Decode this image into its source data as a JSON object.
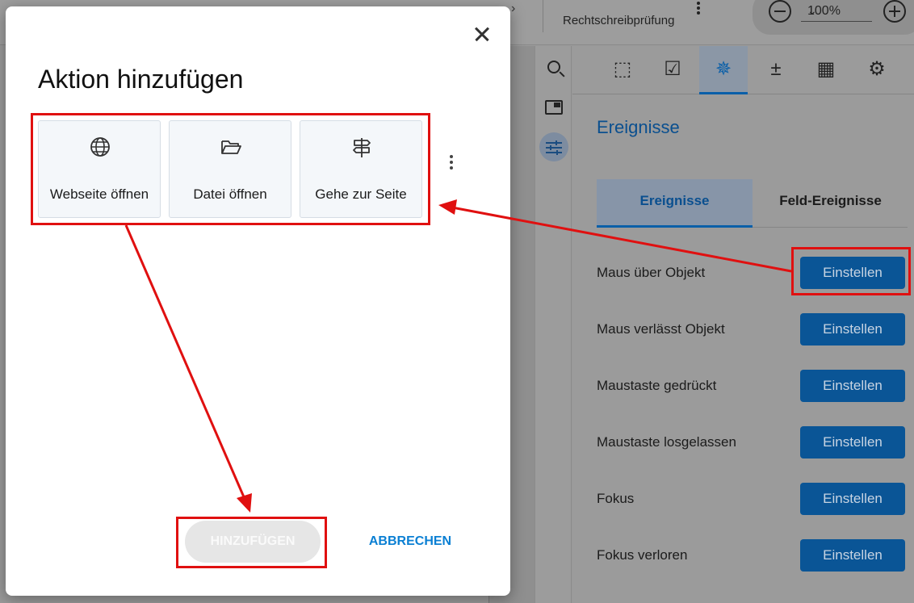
{
  "toolbar": {
    "spellcheck_label": "Rechtschreibprüfung",
    "zoom_value": "100%"
  },
  "right_panel": {
    "tabs": [
      "form-icon",
      "checkbox-icon",
      "click-events-icon",
      "calc-currency-icon",
      "calculator-icon",
      "settings-gear-icon"
    ],
    "title": "Ereignisse",
    "subtabs": [
      {
        "label": "Ereignisse",
        "active": true
      },
      {
        "label": "Feld-Ereignisse",
        "active": false
      }
    ],
    "events": [
      {
        "label": "Maus über Objekt",
        "button": "Einstellen"
      },
      {
        "label": "Maus verlässt Objekt",
        "button": "Einstellen"
      },
      {
        "label": "Maustaste gedrückt",
        "button": "Einstellen"
      },
      {
        "label": "Maustaste losgelassen",
        "button": "Einstellen"
      },
      {
        "label": "Fokus",
        "button": "Einstellen"
      },
      {
        "label": "Fokus verloren",
        "button": "Einstellen"
      }
    ]
  },
  "dialog": {
    "title": "Aktion hinzufügen",
    "actions": [
      {
        "label": "Webseite öffnen",
        "icon": "globe-icon"
      },
      {
        "label": "Datei öffnen",
        "icon": "folder-open-icon"
      },
      {
        "label": "Gehe zur Seite",
        "icon": "signpost-icon"
      }
    ],
    "add_button": "HINZUFÜGEN",
    "cancel_button": "ABBRECHEN"
  },
  "colors": {
    "accent": "#0a7fd3",
    "event_button": "#0a5596",
    "annotation": "#e01010"
  }
}
